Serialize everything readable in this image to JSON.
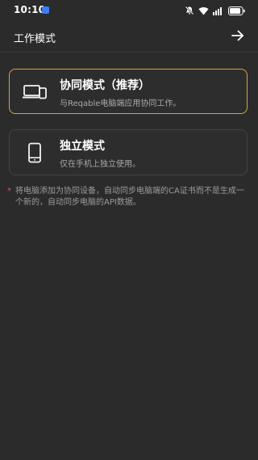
{
  "status_bar": {
    "time": "10:10",
    "icons": [
      "app-notification-icon",
      "bell-muted-icon",
      "wifi-icon",
      "signal-icon",
      "battery-icon"
    ]
  },
  "app_bar": {
    "title": "工作模式",
    "next_icon": "arrow-right-icon"
  },
  "modes": [
    {
      "icon": "devices-icon",
      "title": "协同模式（推荐）",
      "description": "与Reqable电脑端应用协同工作。",
      "selected": true
    },
    {
      "icon": "phone-icon",
      "title": "独立模式",
      "description": "仅在手机上独立使用。",
      "selected": false
    }
  ],
  "note": {
    "marker": "*",
    "text": "将电脑添加为协同设备，自动同步电脑端的CA证书而不是生成一个新的，自动同步电脑的API数据。"
  },
  "colors": {
    "background": "#2b2b2b",
    "selected_border": "#d9a438",
    "card_border": "#444444",
    "note_marker": "#e05252",
    "status_app_dot": "#3d7bf6"
  }
}
